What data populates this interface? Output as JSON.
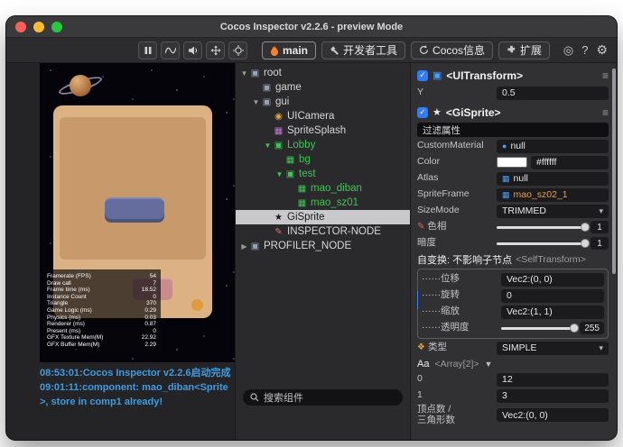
{
  "window": {
    "title": "Cocos Inspector v2.2.6 - preview Mode"
  },
  "toolbar": {
    "buttons": [
      "pause",
      "activity-curve",
      "audio",
      "move",
      "locate"
    ],
    "tabs": [
      {
        "label": "main",
        "icon": "flame-icon",
        "active": true
      },
      {
        "label": "开发者工具",
        "icon": "tools-icon",
        "active": false
      },
      {
        "label": "Cocos信息",
        "icon": "refresh-icon",
        "active": false
      },
      {
        "label": "扩展",
        "icon": "extension-icon",
        "active": false
      }
    ],
    "right": [
      "◎",
      "?",
      "⚙"
    ]
  },
  "preview": {
    "stats": [
      {
        "label": "Framerate (FPS)",
        "value": "54"
      },
      {
        "label": "Draw call",
        "value": "7"
      },
      {
        "label": "Frame time (ms)",
        "value": "18.52"
      },
      {
        "label": "Instance Count",
        "value": "0"
      },
      {
        "label": "Triangle",
        "value": "370"
      },
      {
        "label": "Game Logic (ms)",
        "value": "0.29"
      },
      {
        "label": "Physics (ms)",
        "value": "0.03"
      },
      {
        "label": "Renderer (ms)",
        "value": "0.87"
      },
      {
        "label": "Present (ms)",
        "value": "0"
      },
      {
        "label": "GFX Texture Mem(M)",
        "value": "22.92"
      },
      {
        "label": "GFX Buffer Mem(M)",
        "value": "2.29"
      }
    ]
  },
  "console": {
    "lines": [
      "08:53:01:Cocos Inspector v2.2.6启动完成",
      "09:01:11:component: mao_diban<Sprite>, store in comp1 already!"
    ]
  },
  "search": {
    "placeholder": "搜索组件"
  },
  "tree": {
    "items": [
      {
        "label": "root",
        "depth": 0,
        "expander": "▼",
        "icon": "node-icon"
      },
      {
        "label": "game",
        "depth": 1,
        "expander": "",
        "icon": "node-icon"
      },
      {
        "label": "gui",
        "depth": 1,
        "expander": "▼",
        "icon": "node-icon"
      },
      {
        "label": "UICamera",
        "depth": 2,
        "expander": "",
        "icon": "camera-icon"
      },
      {
        "label": "SpriteSplash",
        "depth": 2,
        "expander": "",
        "icon": "splash-icon"
      },
      {
        "label": "Lobby",
        "depth": 2,
        "expander": "▼",
        "icon": "frame-green-icon",
        "green": true
      },
      {
        "label": "bg",
        "depth": 3,
        "expander": "",
        "icon": "image-green-icon",
        "green": true
      },
      {
        "label": "test",
        "depth": 3,
        "expander": "▼",
        "icon": "frame-green-icon",
        "green": true
      },
      {
        "label": "mao_diban",
        "depth": 4,
        "expander": "",
        "icon": "image-green-icon",
        "green": true
      },
      {
        "label": "mao_sz01",
        "depth": 4,
        "expander": "",
        "icon": "image-green-icon",
        "green": true
      },
      {
        "label": "GiSprite",
        "depth": 2,
        "expander": "",
        "icon": "star-icon",
        "selected": true
      },
      {
        "label": "INSPECTOR-NODE",
        "depth": 2,
        "expander": "",
        "icon": "pencil-icon"
      },
      {
        "label": "PROFILER_NODE",
        "depth": 0,
        "expander": "▶",
        "icon": "node-icon"
      }
    ]
  },
  "inspector": {
    "rows": [
      {
        "kind": "header",
        "name": "uitransform-header",
        "icon": "uitransform-icon",
        "label": "<UITransform>",
        "checked": true
      },
      {
        "kind": "field",
        "name": "y-field",
        "label": "Y",
        "value": "0.5"
      },
      {
        "kind": "header",
        "name": "gisprite-header",
        "icon": "gisprite-icon",
        "label": "<GiSprite>",
        "checked": true
      },
      {
        "kind": "filter",
        "name": "filter-properties",
        "placeholder": "过滤属性"
      },
      {
        "kind": "asset",
        "name": "custom-material",
        "label": "CustomMaterial",
        "vicon": "material-icon",
        "value": "null"
      },
      {
        "kind": "color",
        "name": "color",
        "label": "Color",
        "swatch": "#ffffff",
        "value": "#ffffff"
      },
      {
        "kind": "asset",
        "name": "atlas",
        "label": "Atlas",
        "vicon": "atlas-icon",
        "value": "null"
      },
      {
        "kind": "asset",
        "name": "sprite-frame",
        "label": "SpriteFrame",
        "vicon": "spriteframe-icon",
        "value": "mao_sz02_1",
        "highlight": true
      },
      {
        "kind": "dropdown",
        "name": "size-mode",
        "label": "SizeMode",
        "value": "TRIMMED"
      },
      {
        "kind": "slider",
        "name": "hue-slider",
        "label": "色相",
        "icon": "brush-icon",
        "value": "1",
        "pos": 1
      },
      {
        "kind": "slider",
        "name": "darkness-slider",
        "label": "暗度",
        "value": "1",
        "pos": 1
      },
      {
        "kind": "section",
        "name": "self-transform-section",
        "label": "自变换: 不影响子节点",
        "type": "<SelfTransform>"
      },
      {
        "kind": "group",
        "name": "self-transform-group",
        "rows": [
          {
            "kind": "field",
            "name": "position",
            "label": "······位移",
            "value": "Vec2:(0, 0)"
          },
          {
            "kind": "field",
            "name": "rotation",
            "label": "······旋转",
            "value": "0"
          },
          {
            "kind": "field",
            "name": "scale",
            "label": "······缩放",
            "value": "Vec2:(1, 1)"
          },
          {
            "kind": "slider",
            "name": "opacity-slider",
            "label": "······透明度",
            "value": "255",
            "pos": 1
          }
        ]
      },
      {
        "kind": "dropdown",
        "name": "type-dropdown",
        "label": "类型",
        "icon": "palette-icon",
        "value": "SIMPLE"
      },
      {
        "kind": "array",
        "name": "array-aa",
        "label": "Aa",
        "type": "<Array[2]>",
        "arrow": "▼"
      },
      {
        "kind": "field",
        "name": "array-item-0",
        "label": "0",
        "value": "12"
      },
      {
        "kind": "field",
        "name": "array-item-1",
        "label": "1",
        "value": "3"
      },
      {
        "kind": "field",
        "name": "vertex-triangle-count",
        "label": "顶点数 /\n三角形数",
        "value": "Vec2:(0, 0)"
      }
    ]
  }
}
